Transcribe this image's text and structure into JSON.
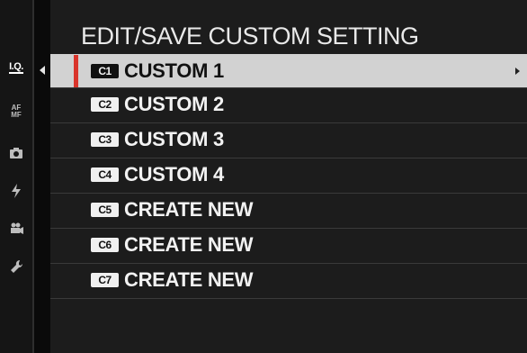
{
  "menu": {
    "title": "EDIT/SAVE CUSTOM SETTING",
    "rows": [
      {
        "badge": "C1",
        "label": "CUSTOM 1"
      },
      {
        "badge": "C2",
        "label": "CUSTOM 2"
      },
      {
        "badge": "C3",
        "label": "CUSTOM 3"
      },
      {
        "badge": "C4",
        "label": "CUSTOM 4"
      },
      {
        "badge": "C5",
        "label": "CREATE NEW"
      },
      {
        "badge": "C6",
        "label": "CREATE NEW"
      },
      {
        "badge": "C7",
        "label": "CREATE NEW"
      }
    ]
  },
  "rail": {
    "iq": "I.Q.",
    "af": "AF",
    "mf": "MF",
    "icons": [
      "camera-icon",
      "flash-icon",
      "movie-icon",
      "wrench-icon"
    ]
  },
  "colors": {
    "selected_row": "#d2d2d2",
    "marker": "#d9342b",
    "panel": "#1c1c1c",
    "text": "#f2f2f2"
  }
}
